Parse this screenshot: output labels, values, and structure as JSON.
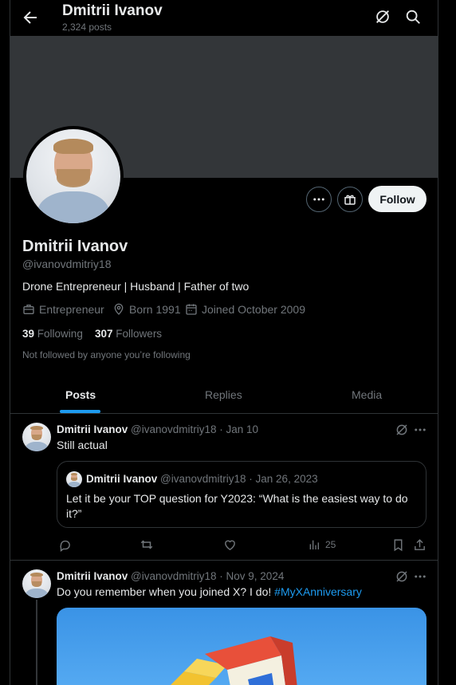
{
  "header": {
    "title": "Dmitrii Ivanov",
    "posts_count": "2,324 posts"
  },
  "profile": {
    "name": "Dmitrii Ivanov",
    "handle": "@ivanovdmitriy18",
    "bio": "Drone Entrepreneur | Husband | Father of two",
    "category": "Entrepreneur",
    "born": "Born 1991",
    "joined": "Joined October 2009",
    "following_count": "39",
    "following_label": "Following",
    "followers_count": "307",
    "followers_label": "Followers",
    "not_followed_text": "Not followed by anyone you’re following",
    "follow_label": "Follow"
  },
  "tabs": [
    {
      "label": "Posts",
      "active": true
    },
    {
      "label": "Replies",
      "active": false
    },
    {
      "label": "Media",
      "active": false
    }
  ],
  "posts": [
    {
      "author": "Dmitrii Ivanov",
      "handle_date": "@ivanovdmitriy18 · Jan 10",
      "text": "Still actual",
      "quote": {
        "author": "Dmitrii Ivanov",
        "handle_date": "@ivanovdmitriy18 · Jan 26, 2023",
        "text": "Let it be your TOP question for Y2023: “What is the easiest way to do it?”"
      },
      "views": "25"
    },
    {
      "author": "Dmitrii Ivanov",
      "handle_date": "@ivanovdmitriy18 · Nov 9, 2024",
      "text": "Do you remember when you joined X? I do! ",
      "hashtag": "#MyXAnniversary"
    }
  ],
  "colors": {
    "background": "#000000",
    "banner": "#333639",
    "accent": "#1d9bf0",
    "muted": "#71767b",
    "border": "#2f3336"
  },
  "icons": [
    "back-arrow-icon",
    "grok-icon",
    "search-icon",
    "more-icon",
    "gift-icon",
    "briefcase-icon",
    "location-icon",
    "calendar-icon",
    "reply-icon",
    "repost-icon",
    "like-icon",
    "views-icon",
    "bookmark-icon",
    "share-icon"
  ]
}
